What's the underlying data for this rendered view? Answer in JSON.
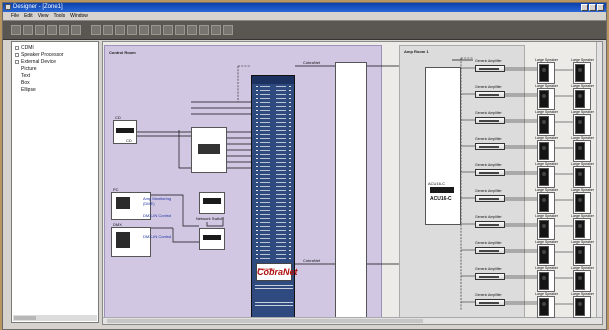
{
  "window": {
    "title": "Designer - [Zone1]"
  },
  "menu": [
    "File",
    "Edit",
    "View",
    "Tools",
    "Window"
  ],
  "toolbar_icon_count": 18,
  "tree": {
    "items": [
      "CDMI",
      "Speaker Processor",
      "External Device",
      "Picture",
      "Text",
      "Box",
      "Ellipse"
    ]
  },
  "canvas": {
    "room1_label": "Control Room",
    "room2_label": "Amp Room 1",
    "device_labels": {
      "cd": "CD",
      "dmx": "DMX",
      "dmx_sub": "DMX-IN Control",
      "monitoring": "Amp Monitoring",
      "monitoring_sub": "(DME)",
      "network_switch": "Network Switch",
      "cobranet_top": "CobraNet",
      "cobranet_bottom": "CobraNet",
      "cobra_logo": "CobraNet",
      "cobra_logo_sub": "Powered by",
      "cobranet_label": "CobraNet",
      "acu": "ACU16-C",
      "acu_big": "ACU16-C"
    },
    "amplifier_label": "Generic Amplifier",
    "speaker_label": "Large Speaker",
    "colors": {
      "room1": "#d1c7e3",
      "room2": "#dcdcdc",
      "cobranet": "#2e4a7e"
    }
  }
}
